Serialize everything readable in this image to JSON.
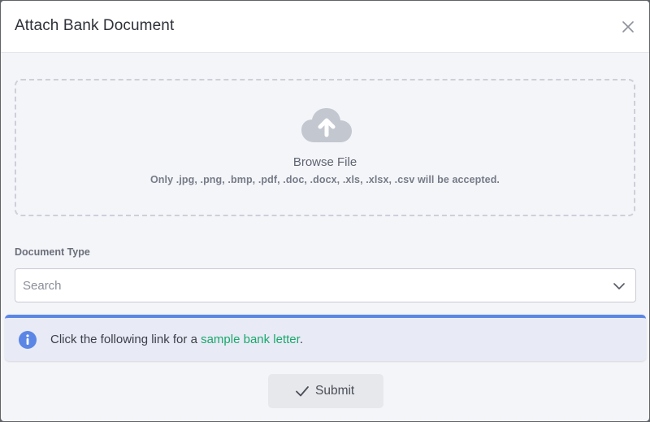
{
  "modal": {
    "title": "Attach Bank Document",
    "close_icon": "close-icon"
  },
  "dropzone": {
    "icon": "cloud-upload-icon",
    "browse_label": "Browse File",
    "accept_note": "Only .jpg, .png, .bmp, .pdf, .doc, .docx, .xls, .xlsx, .csv will be accepted."
  },
  "document_type": {
    "label": "Document Type",
    "placeholder": "Search",
    "icon": "chevron-down-icon"
  },
  "info": {
    "icon": "info-icon",
    "text_prefix": "Click the following link for a ",
    "link_text": "sample bank letter",
    "text_suffix": "."
  },
  "submit": {
    "icon": "check-icon",
    "label": "Submit"
  },
  "colors": {
    "accent_blue": "#5b86e5",
    "link_green": "#1aa86a",
    "panel_bg": "#f4f5f9"
  }
}
